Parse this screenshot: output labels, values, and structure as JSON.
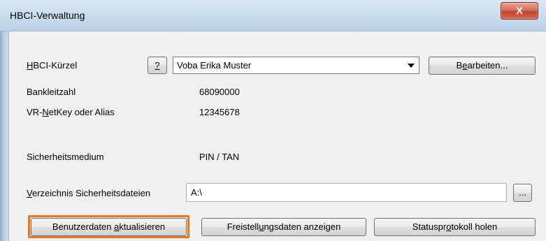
{
  "window": {
    "title": "HBCI-Verwaltung",
    "close_glyph": "X"
  },
  "hbci": {
    "label_prefix": "",
    "label_u": "H",
    "label_rest": "BCI-Kürzel",
    "help_label": "?",
    "selected": "Voba Erika Muster",
    "edit_button": {
      "pre": "B",
      "u": "e",
      "post": "arbeiten..."
    }
  },
  "fields": {
    "bankleitzahl_label": "Bankleitzahl",
    "bankleitzahl_value": "68090000",
    "netkey_label_pre": "VR-",
    "netkey_label_u": "N",
    "netkey_label_post": "etKey oder Alias",
    "netkey_value": "12345678",
    "medium_label": "Sicherheitsmedium",
    "medium_value": "PIN / TAN"
  },
  "directory": {
    "label_u": "V",
    "label_rest": "erzeichnis Sicherheitsdateien",
    "value": "A:\\",
    "browse_label": "..."
  },
  "actions": {
    "update": {
      "pre": "Benutzerdaten ",
      "u": "a",
      "post": "ktualisieren"
    },
    "freistellung": {
      "pre": "Freistell",
      "u": "u",
      "post": "ngsdaten anzeigen"
    },
    "status": {
      "pre": "Statuspr",
      "u": "o",
      "post": "tokoll holen"
    }
  },
  "colors": {
    "focus": "#e87722"
  }
}
